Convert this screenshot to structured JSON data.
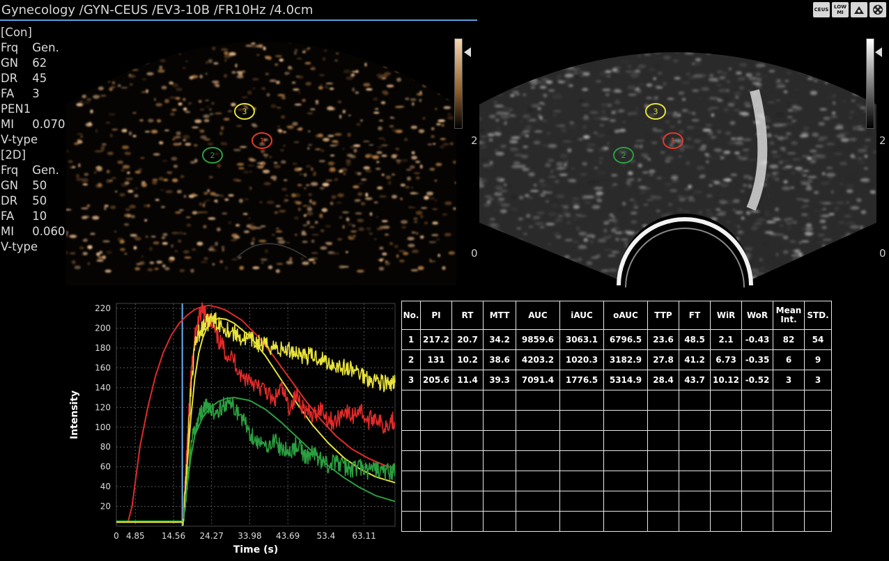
{
  "header": {
    "title": "Gynecology /GYN-CEUS /EV3-10B /FR10Hz /4.0cm",
    "icons": [
      {
        "name": "ceus-mode-icon",
        "label": "CEUS"
      },
      {
        "name": "low-mi-icon",
        "label": "LOW MI"
      },
      {
        "name": "probe-mode-icon",
        "label": ""
      },
      {
        "name": "film-reel-icon",
        "label": ""
      }
    ]
  },
  "params": {
    "con": {
      "header": "[Con]",
      "rows": [
        [
          "Frq",
          "Gen."
        ],
        [
          "GN",
          "62"
        ],
        [
          "DR",
          "45"
        ],
        [
          "FA",
          "3"
        ],
        [
          "PEN1",
          ""
        ],
        [
          "MI",
          "0.070"
        ],
        [
          "V-type",
          ""
        ]
      ]
    },
    "twod": {
      "header": "[2D]",
      "rows": [
        [
          "Frq",
          "Gen."
        ],
        [
          "GN",
          "50"
        ],
        [
          "DR",
          "50"
        ],
        [
          "FA",
          "10"
        ],
        [
          "MI",
          "0.060"
        ],
        [
          "V-type",
          ""
        ]
      ]
    }
  },
  "scales": {
    "left_top": "2",
    "left_bottom": "",
    "right_top": "2",
    "right_bottom": "0",
    "mid_top": "2",
    "mid_bottom": "0"
  },
  "rois": [
    {
      "id": "1",
      "color": "#e23a2a"
    },
    {
      "id": "2",
      "color": "#2aa040"
    },
    {
      "id": "3",
      "color": "#e8e23a"
    }
  ],
  "chart_data": {
    "type": "line",
    "xlabel": "Time (s)",
    "ylabel": "Intensity",
    "xlim": [
      0,
      71
    ],
    "ylim": [
      0,
      225
    ],
    "xticks": [
      "0",
      "4.85",
      "14.56",
      "24.27",
      "33.98",
      "43.69",
      "53.4",
      "63.11"
    ],
    "xtick_values": [
      0,
      4.85,
      14.56,
      24.27,
      33.98,
      43.69,
      53.4,
      63.11
    ],
    "yticks": [
      20,
      40,
      60,
      80,
      100,
      120,
      140,
      160,
      180,
      200,
      220
    ],
    "marker_x": 16.8,
    "series": [
      {
        "color": "#e22a2a",
        "x": [
          3,
          4,
          6,
          8,
          10,
          12,
          14,
          16,
          18,
          20,
          22,
          23.6,
          26,
          28,
          32,
          36,
          40,
          44,
          48,
          52,
          56,
          60,
          64,
          68,
          71
        ],
        "y": [
          5,
          20,
          80,
          120,
          152,
          176,
          193,
          205,
          213,
          219,
          222,
          223,
          221,
          218,
          208,
          192,
          172,
          150,
          128,
          108,
          91,
          78,
          69,
          62,
          58
        ]
      },
      {
        "color": "#e8e23a",
        "x": [
          17,
          18,
          19,
          20,
          21,
          22,
          23,
          24,
          26,
          28,
          30,
          34,
          38,
          42,
          46,
          50,
          54,
          58,
          62,
          66,
          71
        ],
        "y": [
          5,
          60,
          110,
          150,
          175,
          190,
          200,
          206,
          210,
          209,
          205,
          192,
          172,
          148,
          124,
          102,
          84,
          69,
          58,
          50,
          44
        ]
      },
      {
        "color": "#2aa040",
        "x": [
          17,
          18,
          19,
          20,
          22,
          24,
          26,
          28,
          30,
          34,
          38,
          42,
          46,
          50,
          54,
          58,
          62,
          66,
          71
        ],
        "y": [
          5,
          40,
          70,
          92,
          110,
          120,
          126,
          129,
          130,
          127,
          118,
          105,
          90,
          75,
          61,
          49,
          39,
          31,
          25
        ]
      },
      {
        "color": "#e22a2a",
        "noisy": true,
        "x": [
          17,
          18,
          19,
          20,
          21,
          22,
          23,
          24,
          26,
          28,
          30,
          32,
          34,
          36,
          38,
          40,
          42,
          44,
          46,
          48,
          50,
          52,
          54,
          56,
          58,
          60,
          62,
          64,
          66,
          68,
          70,
          71
        ],
        "y": [
          5,
          80,
          150,
          190,
          210,
          218,
          212,
          205,
          188,
          175,
          168,
          150,
          150,
          140,
          138,
          125,
          140,
          120,
          132,
          118,
          110,
          120,
          108,
          105,
          118,
          110,
          120,
          105,
          112,
          100,
          108,
          105
        ]
      },
      {
        "color": "#e8e23a",
        "noisy": true,
        "x": [
          17,
          18,
          19,
          20,
          21,
          22,
          23,
          24,
          26,
          28,
          30,
          32,
          34,
          36,
          38,
          40,
          42,
          44,
          46,
          48,
          50,
          52,
          54,
          56,
          58,
          60,
          62,
          64,
          66,
          68,
          70,
          71
        ],
        "y": [
          5,
          60,
          140,
          180,
          195,
          200,
          205,
          208,
          206,
          200,
          195,
          190,
          188,
          185,
          182,
          182,
          178,
          178,
          176,
          172,
          172,
          170,
          165,
          163,
          160,
          158,
          155,
          150,
          148,
          145,
          142,
          145
        ]
      },
      {
        "color": "#2aa040",
        "noisy": true,
        "x": [
          17,
          18,
          19,
          20,
          21,
          22,
          23,
          24,
          26,
          28,
          30,
          32,
          34,
          36,
          38,
          40,
          42,
          44,
          46,
          48,
          50,
          52,
          54,
          56,
          58,
          60,
          62,
          64,
          66,
          68,
          70,
          71
        ],
        "y": [
          5,
          40,
          80,
          100,
          110,
          118,
          120,
          115,
          118,
          125,
          120,
          110,
          95,
          85,
          80,
          88,
          78,
          75,
          82,
          70,
          74,
          68,
          62,
          65,
          60,
          58,
          60,
          55,
          58,
          55,
          55,
          56
        ]
      },
      {
        "color": "#1ec81e",
        "flat": true,
        "x": [
          0,
          17
        ],
        "y": [
          5,
          5
        ]
      },
      {
        "color": "#e8e23a",
        "flat": true,
        "x": [
          0,
          17
        ],
        "y": [
          4,
          4
        ]
      }
    ]
  },
  "table": {
    "headers": [
      "No.",
      "PI",
      "RT",
      "MTT",
      "AUC",
      "iAUC",
      "oAUC",
      "TTP",
      "FT",
      "WiR",
      "WoR",
      "Mean\nInt.",
      "STD."
    ],
    "rows": [
      [
        "1",
        "217.2",
        "20.7",
        "34.2",
        "9859.6",
        "3063.1",
        "6796.5",
        "23.6",
        "48.5",
        "2.1",
        "-0.43",
        "82",
        "54"
      ],
      [
        "2",
        "131",
        "10.2",
        "38.6",
        "4203.2",
        "1020.3",
        "3182.9",
        "27.8",
        "41.2",
        "6.73",
        "-0.35",
        "6",
        "9"
      ],
      [
        "3",
        "205.6",
        "11.4",
        "39.3",
        "7091.4",
        "1776.5",
        "5314.9",
        "28.4",
        "43.7",
        "10.12",
        "-0.52",
        "3",
        "3"
      ]
    ],
    "empty_rows": 7
  }
}
